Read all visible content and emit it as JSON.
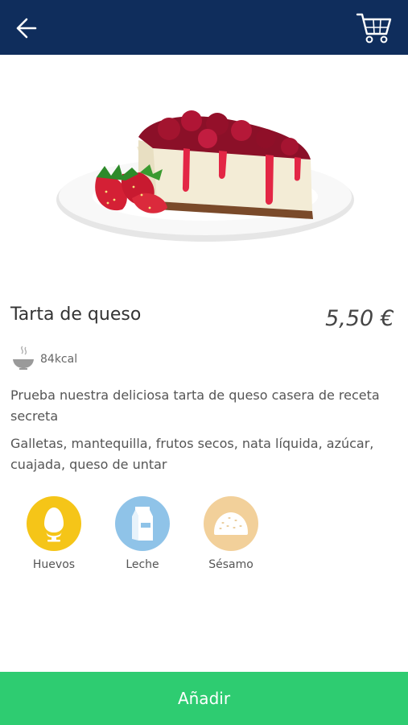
{
  "header": {
    "back_icon": "arrow-left-icon",
    "cart_icon": "cart-icon",
    "background": "#0f2d5c"
  },
  "product": {
    "image": "cheesecake-with-berries",
    "name": "Tarta de queso",
    "price": "5,50 €",
    "kcal": "84kcal",
    "kcal_icon": "steaming-bowl-icon",
    "description": "Prueba nuestra deliciosa tarta de queso casera de receta secreta",
    "ingredients": "Galletas, mantequilla, frutos secos, nata líquida, azúcar, cuajada, queso de untar"
  },
  "allergens": [
    {
      "label": "Huevos",
      "icon": "egg-icon",
      "color": "#f5c518"
    },
    {
      "label": "Leche",
      "icon": "milk-carton-icon",
      "color": "#8fc3e8"
    },
    {
      "label": "Sésamo",
      "icon": "sesame-bun-icon",
      "color": "#f2d09a"
    }
  ],
  "actions": {
    "add_label": "Añadir",
    "add_color": "#2ecc71"
  }
}
